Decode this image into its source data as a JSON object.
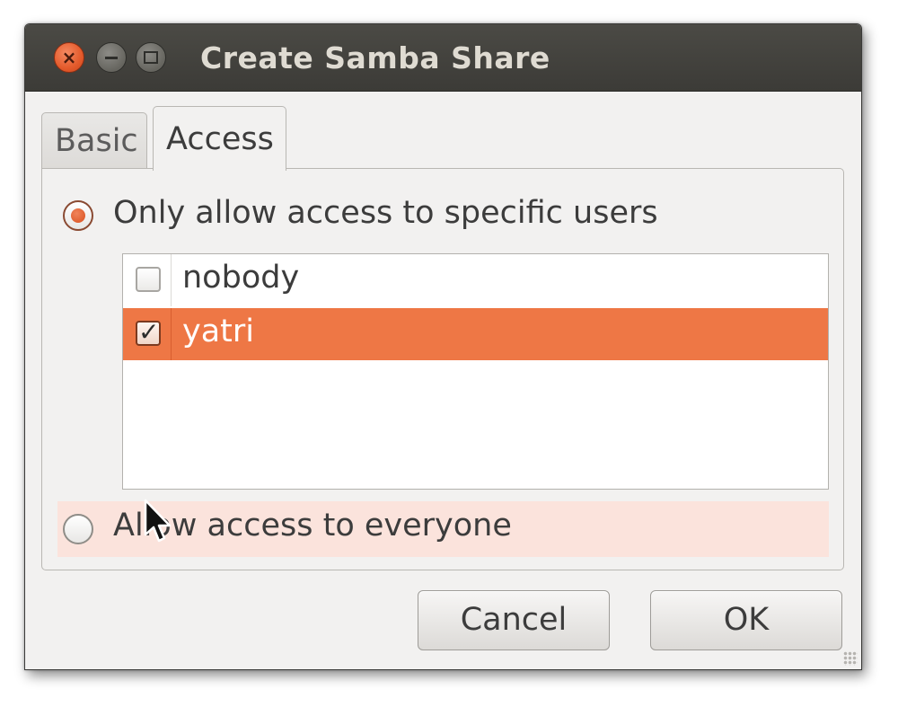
{
  "window": {
    "title": "Create Samba Share",
    "buttons": [
      "close-icon",
      "minimize-icon",
      "maximize-icon"
    ]
  },
  "tabs": [
    {
      "label": "Basic",
      "active": false
    },
    {
      "label": "Access",
      "active": true
    }
  ],
  "access": {
    "option_specific_label": "Only allow access to specific users",
    "option_specific_selected": true,
    "users": [
      {
        "name": "nobody",
        "checked": false,
        "selected": false
      },
      {
        "name": "yatri",
        "checked": true,
        "selected": true
      }
    ],
    "option_everyone_label": "Allow access to everyone",
    "option_everyone_selected": false
  },
  "buttons": {
    "cancel_label": "Cancel",
    "ok_label": "OK"
  },
  "colors": {
    "accent": "#ee7745",
    "titlebar": "#3c3b37",
    "hover_highlight": "#fbe3dc",
    "window_bg": "#f2f1f0"
  }
}
